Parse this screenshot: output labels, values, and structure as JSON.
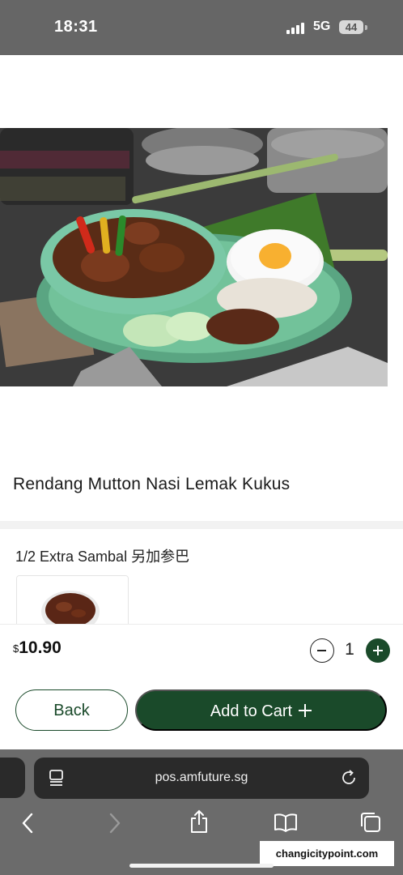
{
  "status_bar": {
    "time": "18:31",
    "network": "5G",
    "battery": "44",
    "icons": [
      "signal-bars-icon",
      "battery-icon"
    ]
  },
  "product": {
    "image_icon": "rendang-mutton-nasi-lemak-photo",
    "title": "Rendang Mutton Nasi Lemak Kukus"
  },
  "option_group": {
    "title": "1/2 Extra Sambal 另加参巴",
    "item_image_icon": "sambal-bowl-photo"
  },
  "order": {
    "currency": "$",
    "price": "10.90",
    "quantity": "1",
    "back_label": "Back",
    "add_to_cart_label": "Add to Cart"
  },
  "browser": {
    "url": "pos.amfuture.sg",
    "icons": [
      "reader-mode-icon",
      "reload-icon",
      "back-arrow-icon",
      "forward-arrow-icon",
      "share-icon",
      "bookmarks-icon",
      "tabs-icon"
    ]
  },
  "watermark": "changicitypoint.com",
  "colors": {
    "brand_green": "#1a4a2a",
    "status_bar_bg": "#666666",
    "browser_bg": "#6b6b6b"
  }
}
